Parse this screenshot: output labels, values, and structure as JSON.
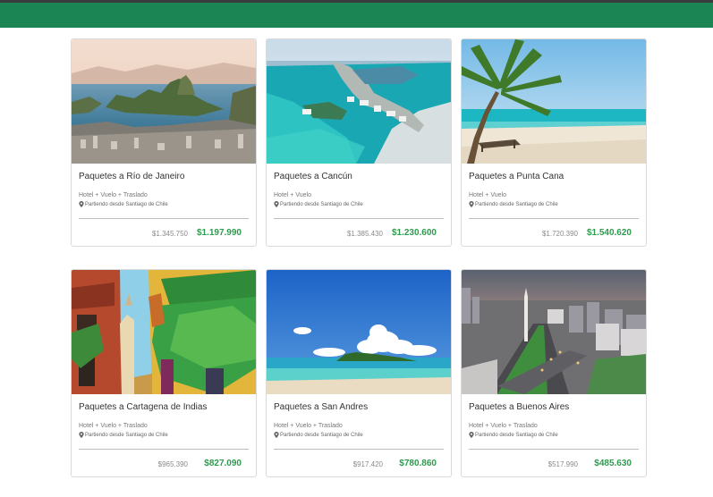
{
  "header": {
    "color": "#1b8553"
  },
  "packages": [
    {
      "title": "Paquetes a Río de Janeiro",
      "features": "Hotel + Vuelo + Traslado",
      "origin": "Partiendo desde Santiago de Chile",
      "old_price": "$1.345.750",
      "price": "$1.197.990"
    },
    {
      "title": "Paquetes a Cancún",
      "features": "Hotel + Vuelo",
      "origin": "Partiendo desde Santiago de Chile",
      "old_price": "$1.385.430",
      "price": "$1.230.600"
    },
    {
      "title": "Paquetes a Punta Cana",
      "features": "Hotel + Vuelo",
      "origin": "Partiendo desde Santiago de Chile",
      "old_price": "$1.720.390",
      "price": "$1.540.620"
    },
    {
      "title": "Paquetes a Cartagena de Indias",
      "features": "Hotel + Vuelo + Traslado",
      "origin": "Partiendo desde Santiago de Chile",
      "old_price": "$965.390",
      "price": "$827.090"
    },
    {
      "title": "Paquetes a San Andres",
      "features": "Hotel + Vuelo + Traslado",
      "origin": "Partiendo desde Santiago de Chile",
      "old_price": "$917.420",
      "price": "$780.860"
    },
    {
      "title": "Paquetes a Buenos Aires",
      "features": "Hotel + Vuelo + Traslado",
      "origin": "Partiendo desde Santiago de Chile",
      "old_price": "$517.990",
      "price": "$485.630"
    }
  ]
}
